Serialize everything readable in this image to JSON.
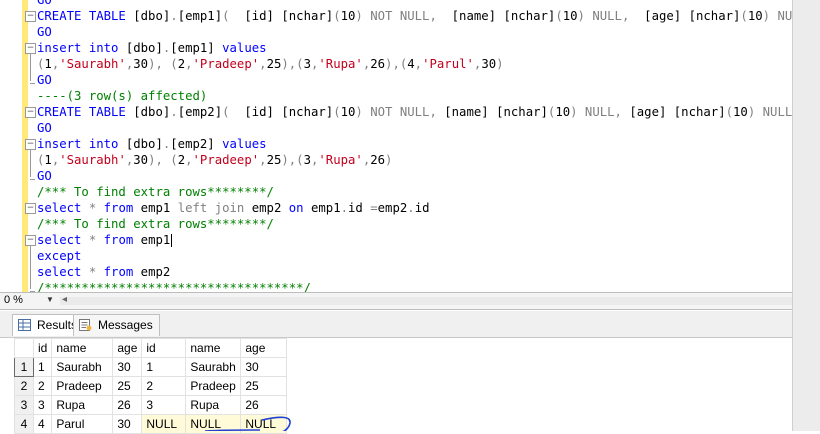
{
  "editor": {
    "lines": [
      [
        {
          "t": "GO",
          "c": "kw"
        }
      ],
      [
        {
          "t": "CREATE TABLE ",
          "c": "kw"
        },
        {
          "t": "[dbo]",
          "c": ""
        },
        {
          "t": ".",
          "c": "gray"
        },
        {
          "t": "[emp1]",
          "c": ""
        },
        {
          "t": "(  ",
          "c": "gray"
        },
        {
          "t": "[id] ",
          "c": ""
        },
        {
          "t": "[nchar]",
          "c": ""
        },
        {
          "t": "(",
          "c": "gray"
        },
        {
          "t": "10",
          "c": ""
        },
        {
          "t": ") NOT NULL,  ",
          "c": "gray"
        },
        {
          "t": "[name] ",
          "c": ""
        },
        {
          "t": "[nchar]",
          "c": ""
        },
        {
          "t": "(",
          "c": "gray"
        },
        {
          "t": "10",
          "c": ""
        },
        {
          "t": ") NULL,  ",
          "c": "gray"
        },
        {
          "t": "[age] ",
          "c": ""
        },
        {
          "t": "[nchar]",
          "c": ""
        },
        {
          "t": "(",
          "c": "gray"
        },
        {
          "t": "10",
          "c": ""
        },
        {
          "t": ") NULL )",
          "c": "gray"
        }
      ],
      [
        {
          "t": "GO",
          "c": "kw"
        }
      ],
      [
        {
          "t": "insert into ",
          "c": "kw"
        },
        {
          "t": "[dbo]",
          "c": ""
        },
        {
          "t": ".",
          "c": "gray"
        },
        {
          "t": "[emp1] ",
          "c": ""
        },
        {
          "t": "values",
          "c": "kw"
        }
      ],
      [
        {
          "t": "(",
          "c": "gray"
        },
        {
          "t": "1",
          "c": ""
        },
        {
          "t": ",",
          "c": "gray"
        },
        {
          "t": "'Saurabh'",
          "c": "str"
        },
        {
          "t": ",",
          "c": "gray"
        },
        {
          "t": "30",
          "c": ""
        },
        {
          "t": "), (",
          "c": "gray"
        },
        {
          "t": "2",
          "c": ""
        },
        {
          "t": ",",
          "c": "gray"
        },
        {
          "t": "'Pradeep'",
          "c": "str"
        },
        {
          "t": ",",
          "c": "gray"
        },
        {
          "t": "25",
          "c": ""
        },
        {
          "t": "),(",
          "c": "gray"
        },
        {
          "t": "3",
          "c": ""
        },
        {
          "t": ",",
          "c": "gray"
        },
        {
          "t": "'Rupa'",
          "c": "str"
        },
        {
          "t": ",",
          "c": "gray"
        },
        {
          "t": "26",
          "c": ""
        },
        {
          "t": "),(",
          "c": "gray"
        },
        {
          "t": "4",
          "c": ""
        },
        {
          "t": ",",
          "c": "gray"
        },
        {
          "t": "'Parul'",
          "c": "str"
        },
        {
          "t": ",",
          "c": "gray"
        },
        {
          "t": "30",
          "c": ""
        },
        {
          "t": ")",
          "c": "gray"
        }
      ],
      [
        {
          "t": "GO",
          "c": "kw"
        }
      ],
      [
        {
          "t": "----(3 row(s) affected)",
          "c": "cm"
        }
      ],
      [
        {
          "t": "CREATE TABLE ",
          "c": "kw"
        },
        {
          "t": "[dbo]",
          "c": ""
        },
        {
          "t": ".",
          "c": "gray"
        },
        {
          "t": "[emp2]",
          "c": ""
        },
        {
          "t": "(  ",
          "c": "gray"
        },
        {
          "t": "[id] ",
          "c": ""
        },
        {
          "t": "[nchar]",
          "c": ""
        },
        {
          "t": "(",
          "c": "gray"
        },
        {
          "t": "10",
          "c": ""
        },
        {
          "t": ") NOT NULL, ",
          "c": "gray"
        },
        {
          "t": "[name] ",
          "c": ""
        },
        {
          "t": "[nchar]",
          "c": ""
        },
        {
          "t": "(",
          "c": "gray"
        },
        {
          "t": "10",
          "c": ""
        },
        {
          "t": ") NULL, ",
          "c": "gray"
        },
        {
          "t": "[age] ",
          "c": ""
        },
        {
          "t": "[nchar]",
          "c": ""
        },
        {
          "t": "(",
          "c": "gray"
        },
        {
          "t": "10",
          "c": ""
        },
        {
          "t": ") NULL )",
          "c": "gray"
        }
      ],
      [
        {
          "t": "GO",
          "c": "kw"
        }
      ],
      [
        {
          "t": "insert into ",
          "c": "kw"
        },
        {
          "t": "[dbo]",
          "c": ""
        },
        {
          "t": ".",
          "c": "gray"
        },
        {
          "t": "[emp2] ",
          "c": ""
        },
        {
          "t": "values",
          "c": "kw"
        }
      ],
      [
        {
          "t": "(",
          "c": "gray"
        },
        {
          "t": "1",
          "c": ""
        },
        {
          "t": ",",
          "c": "gray"
        },
        {
          "t": "'Saurabh'",
          "c": "str"
        },
        {
          "t": ",",
          "c": "gray"
        },
        {
          "t": "30",
          "c": ""
        },
        {
          "t": "), (",
          "c": "gray"
        },
        {
          "t": "2",
          "c": ""
        },
        {
          "t": ",",
          "c": "gray"
        },
        {
          "t": "'Pradeep'",
          "c": "str"
        },
        {
          "t": ",",
          "c": "gray"
        },
        {
          "t": "25",
          "c": ""
        },
        {
          "t": "),(",
          "c": "gray"
        },
        {
          "t": "3",
          "c": ""
        },
        {
          "t": ",",
          "c": "gray"
        },
        {
          "t": "'Rupa'",
          "c": "str"
        },
        {
          "t": ",",
          "c": "gray"
        },
        {
          "t": "26",
          "c": ""
        },
        {
          "t": ")",
          "c": "gray"
        }
      ],
      [
        {
          "t": "GO",
          "c": "kw"
        }
      ],
      [
        {
          "t": "/*** To find extra rows********/",
          "c": "cm"
        }
      ],
      [
        {
          "t": "select ",
          "c": "kw"
        },
        {
          "t": "* ",
          "c": "gray"
        },
        {
          "t": "from ",
          "c": "kw"
        },
        {
          "t": "emp1 ",
          "c": ""
        },
        {
          "t": "left join ",
          "c": "gray"
        },
        {
          "t": "emp2 ",
          "c": ""
        },
        {
          "t": "on ",
          "c": "kw"
        },
        {
          "t": "emp1",
          "c": ""
        },
        {
          "t": ".",
          "c": "gray"
        },
        {
          "t": "id ",
          "c": ""
        },
        {
          "t": "=",
          "c": "gray"
        },
        {
          "t": "emp2",
          "c": ""
        },
        {
          "t": ".",
          "c": "gray"
        },
        {
          "t": "id",
          "c": ""
        }
      ],
      [
        {
          "t": "/*** To find extra rows********/",
          "c": "cm"
        }
      ],
      [
        {
          "t": "select ",
          "c": "kw"
        },
        {
          "t": "* ",
          "c": "gray"
        },
        {
          "t": "from ",
          "c": "kw"
        },
        {
          "t": "emp1 ",
          "c": ""
        }
      ],
      [
        {
          "t": "except",
          "c": "kw"
        }
      ],
      [
        {
          "t": "select ",
          "c": "kw"
        },
        {
          "t": "* ",
          "c": "gray"
        },
        {
          "t": "from ",
          "c": "kw"
        },
        {
          "t": "emp2",
          "c": ""
        }
      ],
      [
        {
          "t": "/***********************************/",
          "c": "cm"
        }
      ]
    ]
  },
  "statusbar": {
    "zoom": "0 %"
  },
  "tabs": [
    {
      "label": "Results",
      "icon": "grid-icon",
      "active": true
    },
    {
      "label": "Messages",
      "icon": "messages-icon",
      "active": false
    }
  ],
  "results": {
    "columns": [
      "id",
      "name",
      "age",
      "id",
      "name",
      "age"
    ],
    "rows": [
      {
        "num": "1",
        "cells": [
          "1",
          "Saurabh",
          "30",
          "1",
          "Saurabh",
          "30"
        ]
      },
      {
        "num": "2",
        "cells": [
          "2",
          "Pradeep",
          "25",
          "2",
          "Pradeep",
          "25"
        ]
      },
      {
        "num": "3",
        "cells": [
          "3",
          "Rupa",
          "26",
          "3",
          "Rupa",
          "26"
        ]
      },
      {
        "num": "4",
        "cells": [
          "4",
          "Parul",
          "30",
          "NULL",
          "NULL",
          "NULL"
        ]
      }
    ]
  },
  "colors": {
    "keyword": "#0000ff",
    "string": "#c3001d",
    "comment": "#008000",
    "operator": "#808080",
    "change_bar": "#ffe97a",
    "null_cell": "#fffbd9",
    "annotation": "#1f3fd6"
  }
}
